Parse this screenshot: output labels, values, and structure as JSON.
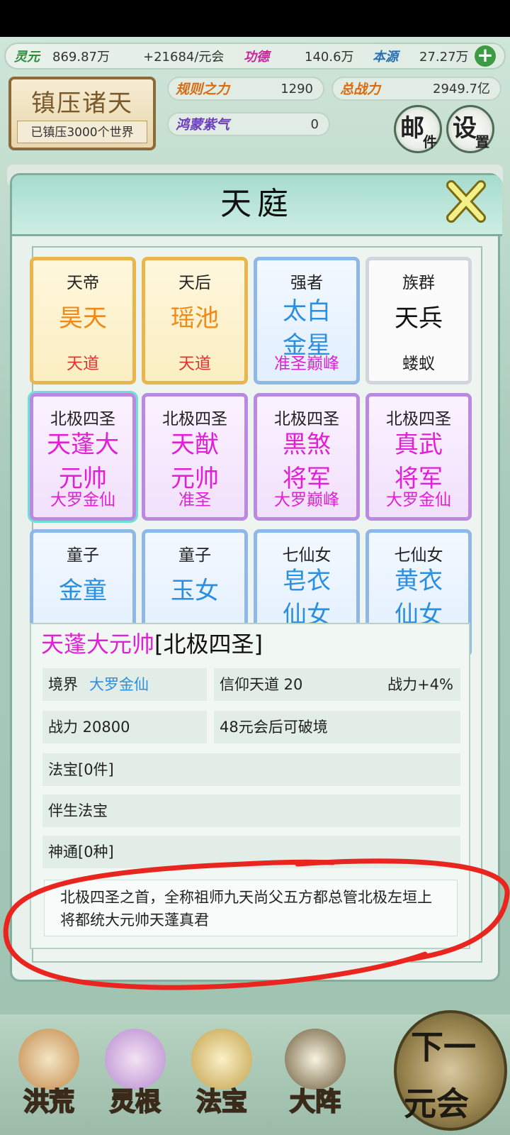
{
  "resources": {
    "lingyuan_label": "灵元",
    "lingyuan_value": "869.87万",
    "lingyuan_rate": "+21684/元会",
    "gongde_label": "功德",
    "gongde_value": "140.6万",
    "benyuan_label": "本源",
    "benyuan_value": "27.27万",
    "add_symbol": "+"
  },
  "title_board": {
    "main": "镇压诸天",
    "sub": "已镇压3000个世界"
  },
  "stats": {
    "rules_label": "规则之力",
    "rules_value": "1290",
    "power_label": "总战力",
    "power_value": "2949.7亿",
    "hongmeng_label": "鸿蒙紫气",
    "hongmeng_value": "0"
  },
  "round_buttons": {
    "mail_big": "邮",
    "mail_small": "件",
    "settings_big": "设",
    "settings_small": "置"
  },
  "modal": {
    "title": "天庭"
  },
  "cards": [
    {
      "role": "天帝",
      "name": "昊天",
      "realm": "天道"
    },
    {
      "role": "天后",
      "name": "瑶池",
      "realm": "天道"
    },
    {
      "role": "强者",
      "name1": "太白",
      "name2": "金星",
      "realm": "准圣巅峰"
    },
    {
      "role": "族群",
      "name": "天兵",
      "realm": "蝼蚁"
    },
    {
      "role": "北极四圣",
      "name1": "天蓬大",
      "name2": "元帅",
      "realm": "大罗金仙"
    },
    {
      "role": "北极四圣",
      "name1": "天猷",
      "name2": "元帅",
      "realm": "准圣"
    },
    {
      "role": "北极四圣",
      "name1": "黑煞",
      "name2": "将军",
      "realm": "大罗巅峰"
    },
    {
      "role": "北极四圣",
      "name1": "真武",
      "name2": "将军",
      "realm": "大罗金仙"
    },
    {
      "role": "童子",
      "name": "金童"
    },
    {
      "role": "童子",
      "name": "玉女"
    },
    {
      "role": "七仙女",
      "name1": "皂衣",
      "name2": "仙女"
    },
    {
      "role": "七仙女",
      "name1": "黄衣",
      "name2": "仙女"
    }
  ],
  "detail": {
    "name": "天蓬大元帅",
    "group": "[北极四圣]",
    "realm_label": "境界",
    "realm_value": "大罗金仙",
    "faith": "信仰天道 20",
    "faith_bonus": "战力+4%",
    "power": "战力 20800",
    "breakthrough": "48元会后可破境",
    "treasures": "法宝[0件]",
    "companion_treasure": "伴生法宝",
    "abilities": "神通[0种]",
    "description": "北极四圣之首，全称祖师九天尚父五方都总管北极左垣上将都统大元帅天蓬真君"
  },
  "bottom_nav": {
    "items": [
      "洪荒",
      "灵根",
      "法宝",
      "大阵"
    ],
    "next1": "下一",
    "next2": "元会"
  },
  "colors": {
    "accent_teal": "#7fae9c",
    "card_gold": "#e8b64c",
    "card_purple": "#b98ae0",
    "card_blue": "#8fb8e8",
    "name_magenta": "#e21fd7",
    "annotation_red": "#e8261f"
  }
}
